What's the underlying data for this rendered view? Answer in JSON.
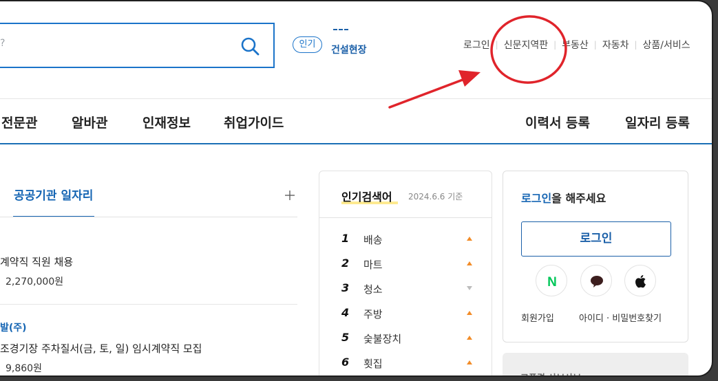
{
  "header": {
    "search": {
      "hint": "?"
    },
    "popular_badge": "인기",
    "popular_keyword": "건설현장",
    "util_links": [
      "로그인",
      "신문지역판",
      "부동산",
      "자동차",
      "상품/서비스"
    ]
  },
  "nav": {
    "left_items": [
      "전문관",
      "알바관",
      "인재정보",
      "취업가이드"
    ],
    "right_items": [
      "이력서 등록",
      "일자리 등록"
    ]
  },
  "jobs_section": {
    "tab_title": "공공기관 일자리",
    "rows": [
      {
        "company": "",
        "title": "계약직 직원 채용",
        "pay": "2,270,000원"
      },
      {
        "company": "발(주)",
        "title": "조경기장 주차질서(금, 토, 일) 임시계약직 모집",
        "pay": "9,860원"
      }
    ]
  },
  "popular_search": {
    "title": "인기검색어",
    "date": "2024.6.6 기준",
    "items": [
      {
        "rank": "1",
        "keyword": "배송",
        "trend": "up"
      },
      {
        "rank": "2",
        "keyword": "마트",
        "trend": "up"
      },
      {
        "rank": "3",
        "keyword": "청소",
        "trend": "down"
      },
      {
        "rank": "4",
        "keyword": "주방",
        "trend": "up"
      },
      {
        "rank": "5",
        "keyword": "숯불장치",
        "trend": "up"
      },
      {
        "rank": "6",
        "keyword": "횟집",
        "trend": "up"
      }
    ]
  },
  "login_panel": {
    "msg_highlight": "로그인",
    "msg_rest": "을 해주세요",
    "button_label": "로그인",
    "social_icons": [
      "naver-icon",
      "kakao-icon",
      "apple-icon"
    ],
    "naver_letter": "N",
    "signup_link": "회원가입",
    "find_link": "아이디 · 비밀번호찾기"
  },
  "ad": {
    "text": "고풍격 샤브샤브"
  },
  "colors": {
    "brand_blue": "#1565b3",
    "annotation_red": "#e0242b",
    "trend_up": "#f28c28",
    "trend_down": "#bdbdbd",
    "naver_green": "#03c75a"
  }
}
